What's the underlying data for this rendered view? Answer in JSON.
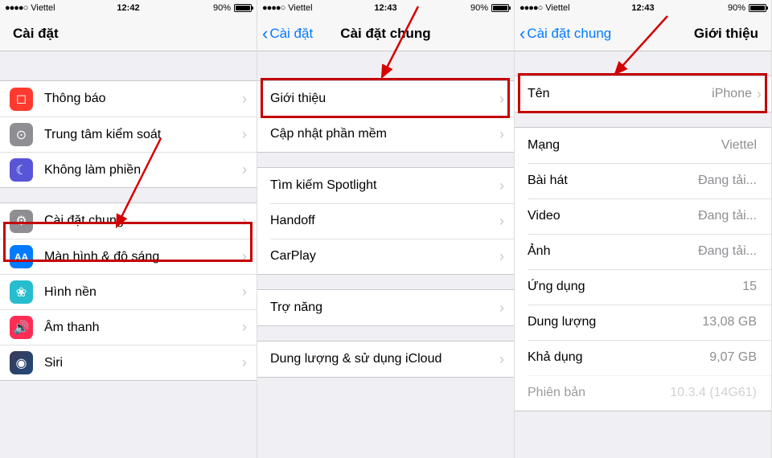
{
  "status": {
    "carrier": "Viettel",
    "signal": "●●●●○",
    "battery": "90%",
    "time1": "12:42",
    "time2": "12:43",
    "time3": "12:43"
  },
  "screen1": {
    "title": "Cài đặt",
    "rows": [
      {
        "id": "notif",
        "label": "Thông báo",
        "icon": "notif",
        "glyph": "◻"
      },
      {
        "id": "ctrl",
        "label": "Trung tâm kiểm soát",
        "icon": "ctrl",
        "glyph": "⊙"
      },
      {
        "id": "dnd",
        "label": "Không làm phiền",
        "icon": "dnd",
        "glyph": "☾"
      },
      {
        "id": "gen",
        "label": "Cài đặt chung",
        "icon": "gen",
        "glyph": "⚙"
      },
      {
        "id": "disp",
        "label": "Màn hình & độ sáng",
        "icon": "disp",
        "glyph": "AA"
      },
      {
        "id": "wall",
        "label": "Hình nền",
        "icon": "wall",
        "glyph": "❀"
      },
      {
        "id": "sound",
        "label": "Âm thanh",
        "icon": "sound",
        "glyph": "🔊"
      },
      {
        "id": "siri",
        "label": "Siri",
        "icon": "siri",
        "glyph": "◉"
      }
    ]
  },
  "screen2": {
    "back": "Cài đặt",
    "title": "Cài đặt chung",
    "group1": [
      {
        "id": "about",
        "label": "Giới thiệu"
      },
      {
        "id": "update",
        "label": "Cập nhật phần mềm"
      }
    ],
    "group2": [
      {
        "id": "spotlight",
        "label": "Tìm kiếm Spotlight"
      },
      {
        "id": "handoff",
        "label": "Handoff"
      },
      {
        "id": "carplay",
        "label": "CarPlay"
      }
    ],
    "group3": [
      {
        "id": "access",
        "label": "Trợ năng"
      }
    ],
    "group4": [
      {
        "id": "storage",
        "label": "Dung lượng & sử dụng iCloud"
      }
    ]
  },
  "screen3": {
    "back": "Cài đặt chung",
    "title": "Giới thiệu",
    "group1": [
      {
        "id": "name",
        "label": "Tên",
        "value": "iPhone",
        "chevron": true
      }
    ],
    "group2": [
      {
        "id": "network",
        "label": "Mạng",
        "value": "Viettel"
      },
      {
        "id": "songs",
        "label": "Bài hát",
        "value": "Đang tải..."
      },
      {
        "id": "videos",
        "label": "Video",
        "value": "Đang tải..."
      },
      {
        "id": "photos",
        "label": "Ảnh",
        "value": "Đang tải..."
      },
      {
        "id": "apps",
        "label": "Ứng dụng",
        "value": "15"
      },
      {
        "id": "capacity",
        "label": "Dung lượng",
        "value": "13,08 GB"
      },
      {
        "id": "avail",
        "label": "Khả dụng",
        "value": "9,07 GB"
      },
      {
        "id": "version",
        "label": "Phiên bản",
        "value": "10.3.4 (14G61)"
      }
    ]
  }
}
